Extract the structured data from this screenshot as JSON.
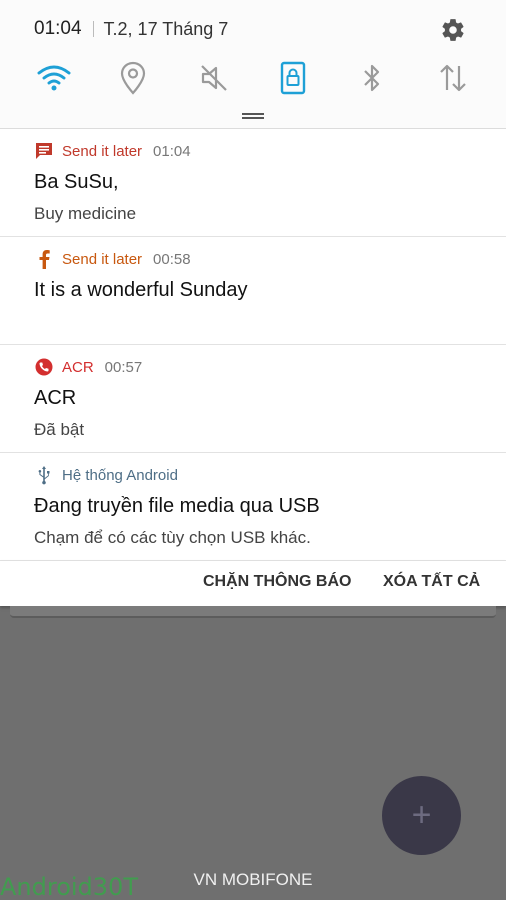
{
  "status": {
    "time": "01:04",
    "date": "T.2, 17 Tháng 7"
  },
  "quick_settings": [
    {
      "icon": "wifi-icon",
      "active": true
    },
    {
      "icon": "location-icon",
      "active": false
    },
    {
      "icon": "mute-icon",
      "active": false
    },
    {
      "icon": "screen-lock-icon",
      "active": true
    },
    {
      "icon": "bluetooth-icon",
      "active": false
    },
    {
      "icon": "data-sync-icon",
      "active": false
    }
  ],
  "notifications": [
    {
      "app": "Send it later",
      "time": "01:04",
      "title": "Ba SuSu,",
      "body": "Buy medicine",
      "icon": "message-icon",
      "color": "#c0392b"
    },
    {
      "app": "Send it later",
      "time": "00:58",
      "title": "It is a wonderful Sunday",
      "body": "",
      "icon": "facebook-icon",
      "color": "#c8580f"
    },
    {
      "app": "ACR",
      "time": "00:57",
      "title": "ACR",
      "body": "Đã bật",
      "icon": "call-recorder-icon",
      "color": "#d32f2f"
    },
    {
      "app": "Hệ thống Android",
      "time": "",
      "title": "Đang truyền file media qua USB",
      "body": "Chạm để có các tùy chọn USB khác.",
      "icon": "usb-icon",
      "color": "#4e6e86"
    }
  ],
  "actions": {
    "block": "CHẶN THÔNG BÁO",
    "clear_all": "XÓA TẤT CẢ"
  },
  "fab": {
    "label": "+"
  },
  "carrier": "VN MOBIFONE",
  "watermark": "Android30T",
  "colors": {
    "accent": "#1ea0d6",
    "inactive_icon": "#9a9a9a"
  }
}
